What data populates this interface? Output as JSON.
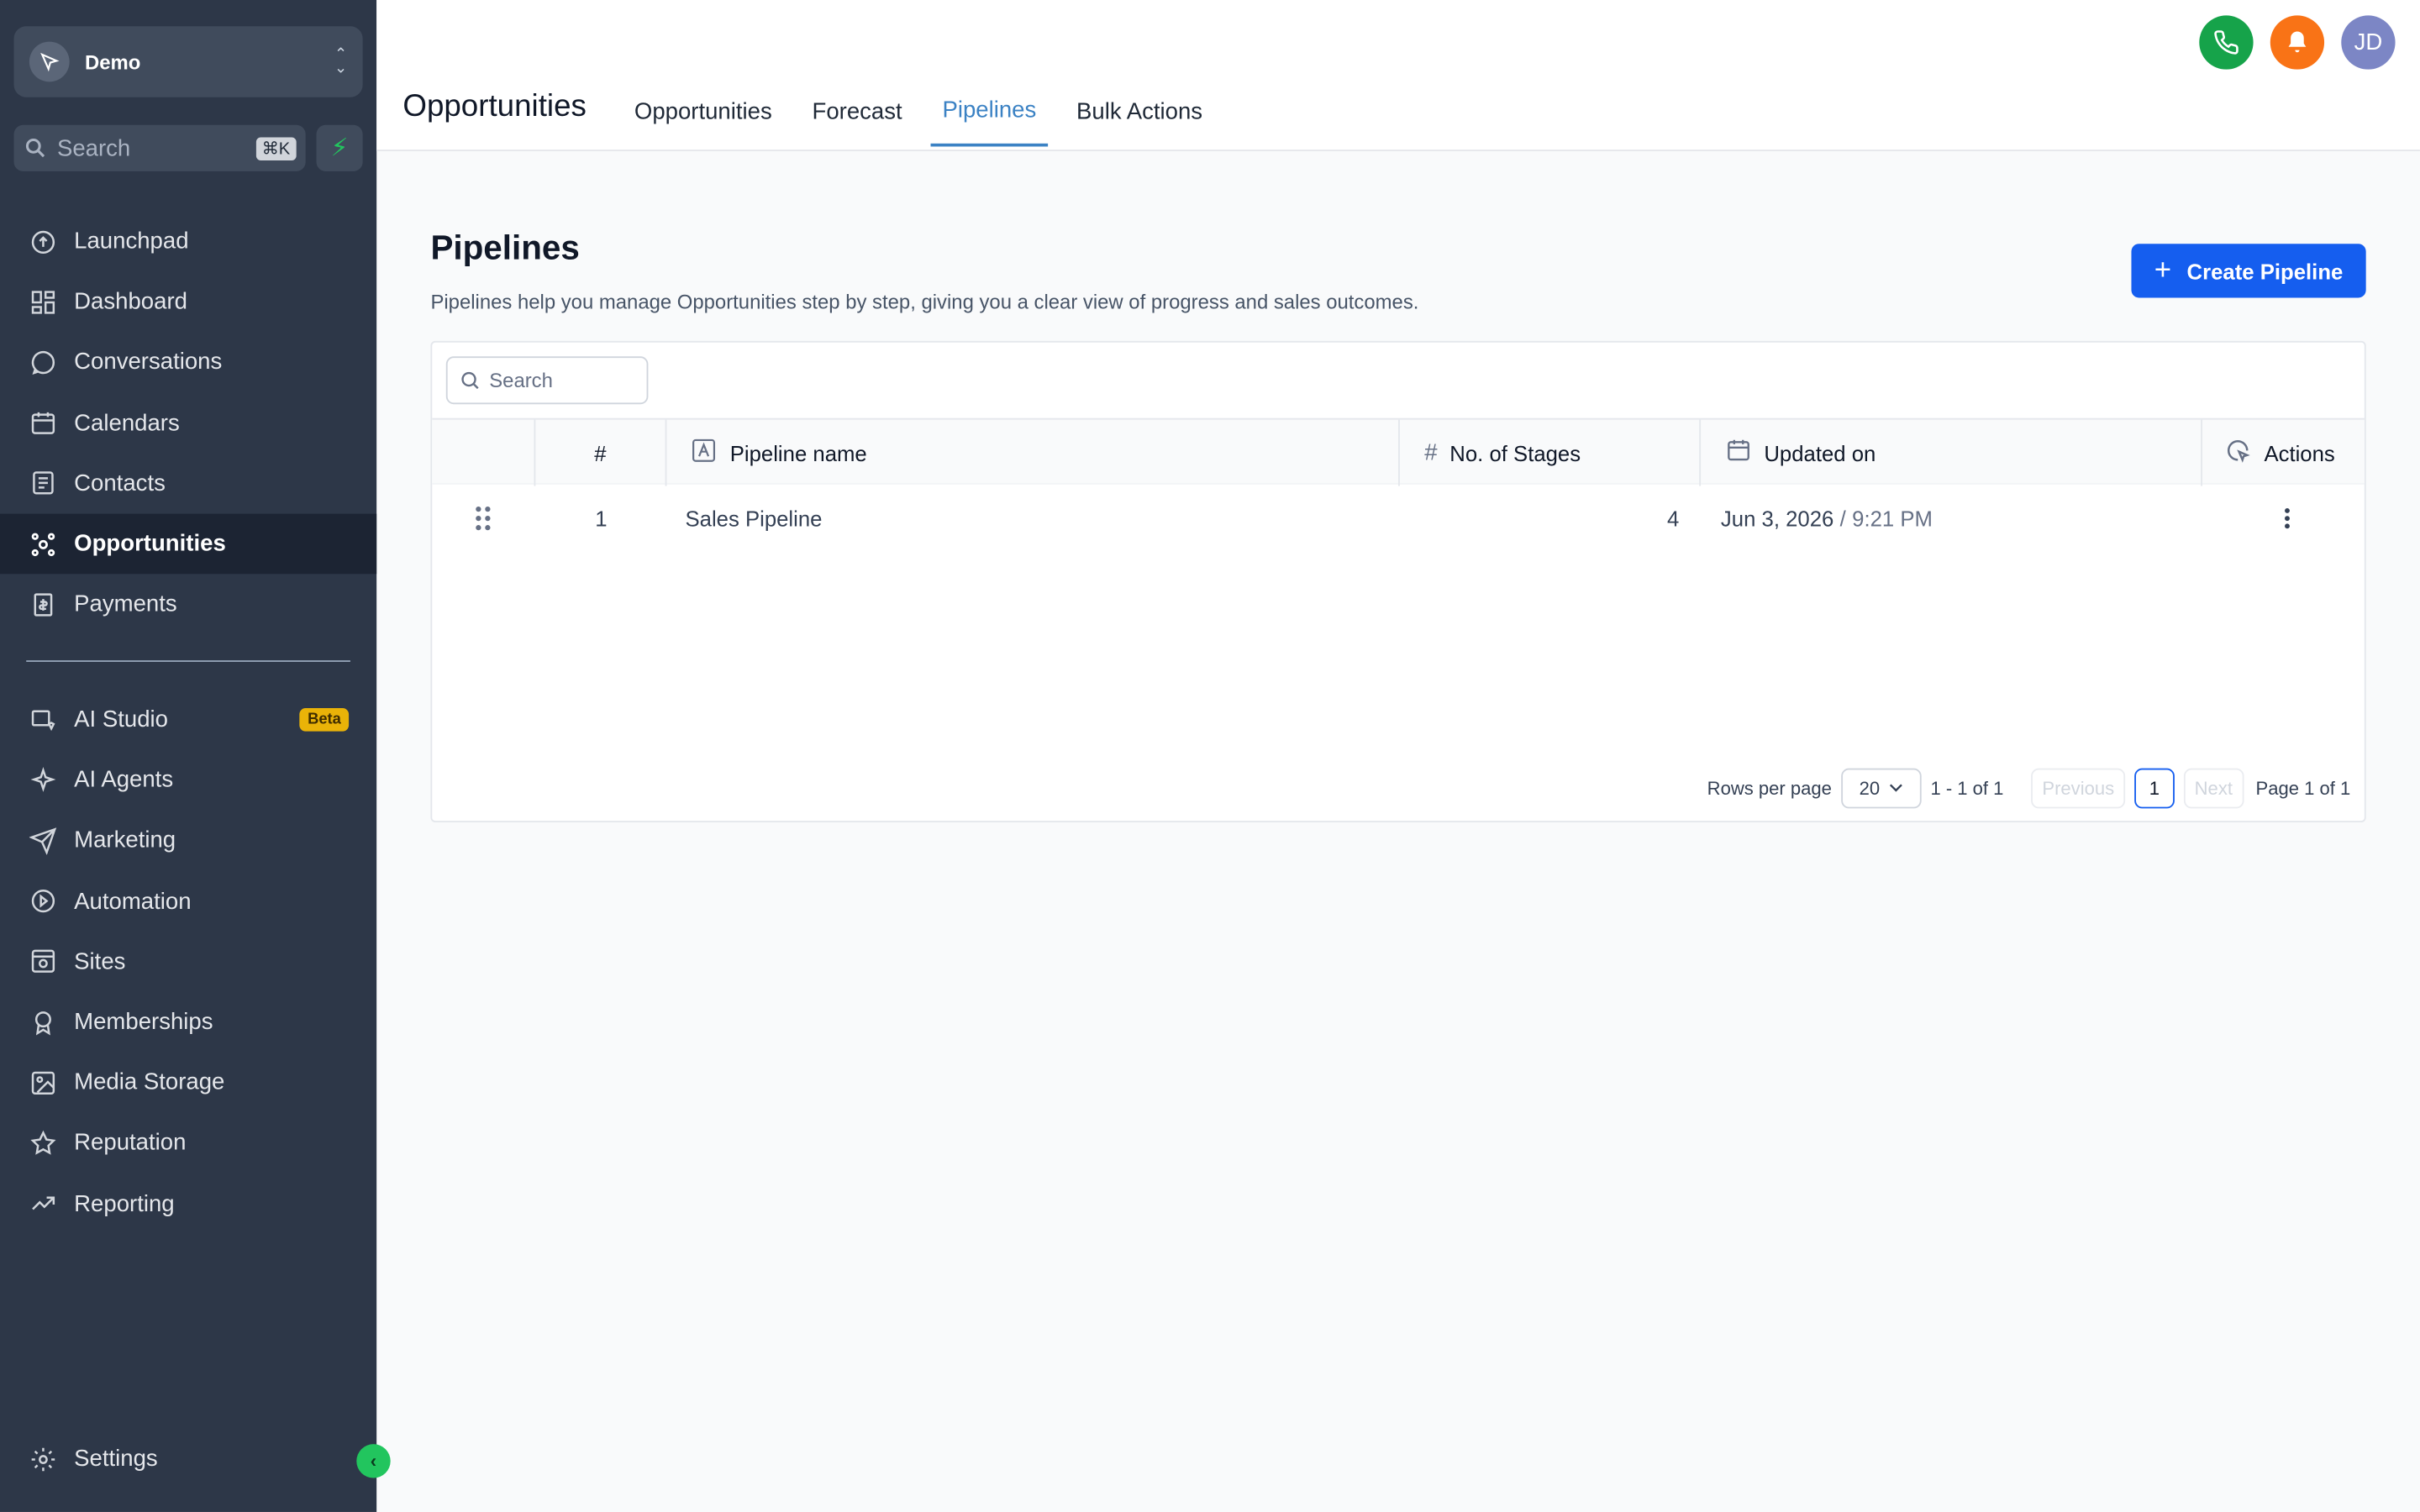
{
  "sidebar": {
    "account_name": "Demo",
    "search_placeholder": "Search",
    "search_shortcut": "⌘K",
    "nav_items": [
      {
        "label": "Launchpad",
        "icon": "launchpad-icon"
      },
      {
        "label": "Dashboard",
        "icon": "dashboard-icon"
      },
      {
        "label": "Conversations",
        "icon": "chat-bubble-icon"
      },
      {
        "label": "Calendars",
        "icon": "calendar-icon"
      },
      {
        "label": "Contacts",
        "icon": "contacts-icon"
      },
      {
        "label": "Opportunities",
        "icon": "opportunities-icon",
        "active": true
      },
      {
        "label": "Payments",
        "icon": "payments-icon"
      }
    ],
    "nav_items_2": [
      {
        "label": "AI Studio",
        "icon": "ai-studio-icon",
        "badge": "Beta"
      },
      {
        "label": "AI Agents",
        "icon": "sparkle-icon"
      },
      {
        "label": "Marketing",
        "icon": "send-icon"
      },
      {
        "label": "Automation",
        "icon": "automation-icon"
      },
      {
        "label": "Sites",
        "icon": "globe-icon"
      },
      {
        "label": "Memberships",
        "icon": "badge-icon"
      },
      {
        "label": "Media Storage",
        "icon": "image-icon"
      },
      {
        "label": "Reputation",
        "icon": "star-icon"
      },
      {
        "label": "Reporting",
        "icon": "trend-icon"
      }
    ],
    "settings_label": "Settings"
  },
  "header": {
    "title": "Opportunities",
    "tabs": [
      "Opportunities",
      "Forecast",
      "Pipelines",
      "Bulk Actions"
    ],
    "active_tab": "Pipelines",
    "avatar_initials": "JD"
  },
  "main": {
    "title": "Pipelines",
    "description": "Pipelines help you manage Opportunities step by step, giving you a clear view of progress and sales outcomes.",
    "create_button": "Create Pipeline",
    "search_placeholder": "Search",
    "columns": {
      "index": "#",
      "name": "Pipeline name",
      "stages": "No. of Stages",
      "updated": "Updated on",
      "actions": "Actions"
    },
    "rows": [
      {
        "index": "1",
        "name": "Sales Pipeline",
        "stages": "4",
        "updated_date": "Jun 3, 2026",
        "updated_sep": "/",
        "updated_time": "9:21 PM"
      }
    ],
    "pagination": {
      "rows_per_page_label": "Rows per page",
      "rows_per_page": "20",
      "range": "1 - 1 of 1",
      "previous": "Previous",
      "current_page": "1",
      "next": "Next",
      "page_info": "Page 1 of 1"
    }
  },
  "colors": {
    "sidebar_bg": "#2d3748",
    "accent": "#155eef",
    "active_tab": "#3b82c4",
    "phone": "#16a34a",
    "bell": "#f97316",
    "avatar": "#7c86c5",
    "badge": "#eab308"
  }
}
